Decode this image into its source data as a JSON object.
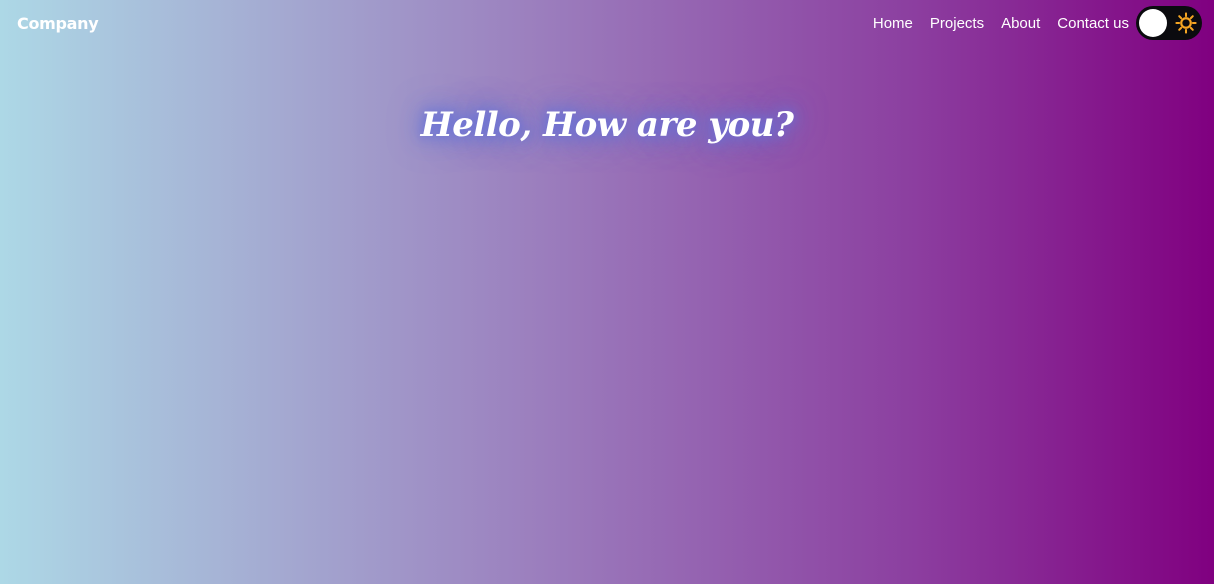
{
  "navbar": {
    "brand": "Company",
    "links": [
      "Home",
      "Projects",
      "About",
      "Contact us"
    ],
    "theme_toggle": {
      "state": "light",
      "icon": "sun-icon",
      "track_color": "#0b0b0f",
      "icon_color": "#f5a623"
    }
  },
  "hero": {
    "title": "Hello, How are you?"
  },
  "colors": {
    "gradient_start": "#add8e6",
    "gradient_end": "#800080",
    "title_glow": "#6a6fd8"
  }
}
